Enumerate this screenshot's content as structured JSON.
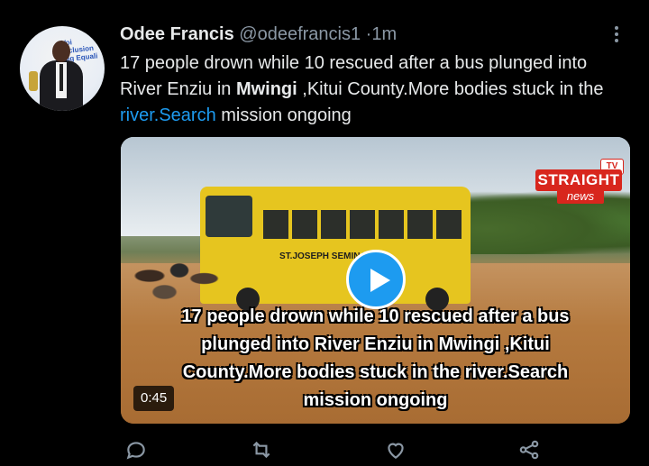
{
  "tweet": {
    "author_name": "Odee Francis",
    "handle": "@odeefrancis1",
    "separator": "·",
    "time": "1m",
    "text_part1": "17 people drown while 10 rescued after a bus plunged into River Enziu in ",
    "text_bold": "Mwingi",
    "text_part2": " ,Kitui County.More bodies stuck in the ",
    "text_link": "river.Search",
    "text_part3": " mission ongoing"
  },
  "avatar": {
    "banner_text": "Voi Inclusion Sig Equali"
  },
  "media": {
    "logo_main": "STRAIGHT",
    "logo_sub": "news",
    "logo_badge": "TV",
    "bus_label": "ST.JOSEPH SEMINARY",
    "caption_lines": [
      "17 people drown while 10 rescued after a bus",
      "plunged into River Enziu in Mwingi ,Kitui",
      "County.More bodies stuck in the river.Search",
      "mission ongoing"
    ],
    "duration": "0:45"
  },
  "actions": [
    "reply-icon",
    "retweet-icon",
    "like-icon",
    "share-icon"
  ],
  "colors": {
    "background": "#000000",
    "text": "#e7e9ea",
    "muted": "#8b98a5",
    "accent": "#1d9bf0",
    "logo_red": "#d8261d"
  }
}
